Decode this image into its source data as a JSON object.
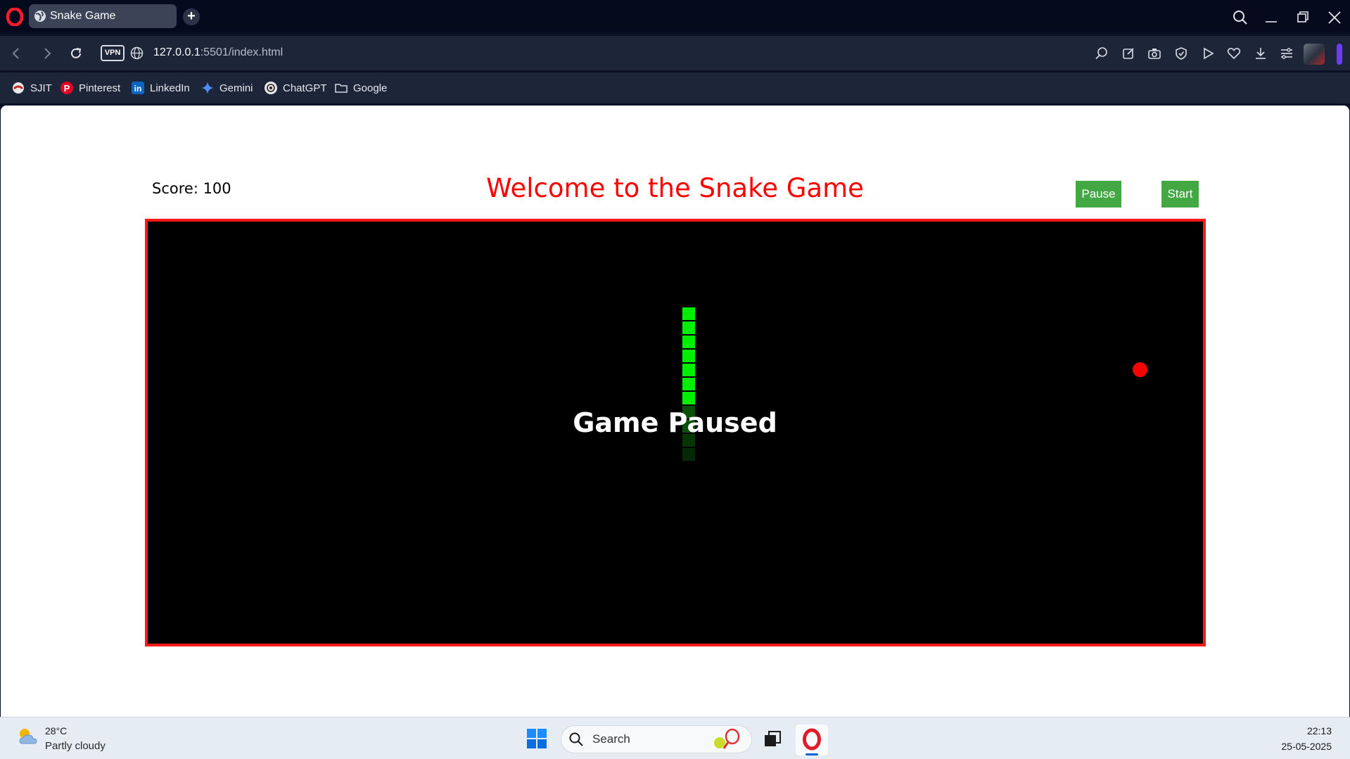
{
  "browser": {
    "tab_title": "Snake Game",
    "address": {
      "host": "127.0.0.1",
      "rest": ":5501/index.html"
    },
    "vpn_label": "VPN",
    "bookmarks": [
      {
        "label": "SJIT",
        "icon": "sjit-icon"
      },
      {
        "label": "Pinterest",
        "icon": "pinterest-icon"
      },
      {
        "label": "LinkedIn",
        "icon": "linkedin-icon"
      },
      {
        "label": "Gemini",
        "icon": "gemini-icon"
      },
      {
        "label": "ChatGPT",
        "icon": "chatgpt-icon"
      },
      {
        "label": "Google",
        "icon": "folder-icon"
      }
    ]
  },
  "game": {
    "score_text": "Score: 100",
    "title": "Welcome to the Snake Game",
    "pause_label": "Pause",
    "start_label": "Start",
    "status_text": "Game Paused",
    "colors": {
      "title": "#ff0000",
      "board_border": "#ff1a1a",
      "snake": "#00ee00",
      "food": "#ff0000",
      "button": "#43a843"
    }
  },
  "taskbar": {
    "weather_temp": "28°C",
    "weather_desc": "Partly cloudy",
    "search_label": "Search",
    "time": "22:13",
    "date": "25-05-2025"
  }
}
